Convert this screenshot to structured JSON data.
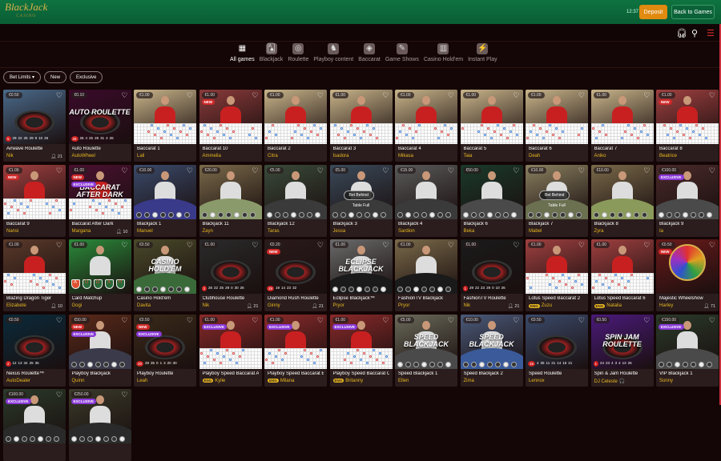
{
  "header": {
    "logo": "BlackJack",
    "logo_sub": "CASINO",
    "clock": "12:37",
    "deposit": "Deposit",
    "back": "Back to Games"
  },
  "tools": {
    "support_icon": "headset-icon",
    "search_icon": "search-icon",
    "menu_icon": "menu-icon"
  },
  "categories": [
    {
      "label": "All games",
      "icon": "grid-icon",
      "glyph": "▦",
      "active": true
    },
    {
      "label": "Blackjack",
      "icon": "cards-icon",
      "glyph": "🂡"
    },
    {
      "label": "Roulette",
      "icon": "roulette-icon",
      "glyph": "◎"
    },
    {
      "label": "Playboy content",
      "icon": "bunny-icon",
      "glyph": "♞"
    },
    {
      "label": "Baccarat",
      "icon": "chips-icon",
      "glyph": "◈"
    },
    {
      "label": "Game Shows",
      "icon": "microphone-icon",
      "glyph": "✎"
    },
    {
      "label": "Casino Hold'em",
      "icon": "holdem-icon",
      "glyph": "▥"
    },
    {
      "label": "Instant Play",
      "icon": "instant-icon",
      "glyph": "⚡"
    }
  ],
  "filters": [
    "Bet Limits ▾",
    "New",
    "Exclusive"
  ],
  "colors": {
    "header": "#0b6a3a",
    "deposit": "#e08a10",
    "dealer": "#e8b820",
    "new": "#d02a2a",
    "exclusive": "#8a3ad8"
  },
  "labels": {
    "new": "NEW",
    "exclusive": "EXCLUSIVE",
    "eng": "ENG",
    "bet_behind": "Bet Behind",
    "table_full": "Table Full"
  },
  "games": [
    {
      "name": "Airwave Roulette",
      "dealer": "Nik",
      "price": "€0.50",
      "players": "21",
      "type": "roulette",
      "scene": "#4a6a8a",
      "nums": [
        "5",
        "29",
        "22",
        "25",
        "29",
        "8",
        "10",
        "26"
      ]
    },
    {
      "name": "Auto Roulette",
      "dealer": "AutoWheel",
      "price": "€0.10",
      "type": "roulette",
      "scene": "#3a0a2a",
      "logo": "AUTO ROULETTE",
      "nums": [
        "25",
        "26",
        "4",
        "25",
        "26",
        "31",
        "4",
        "26"
      ]
    },
    {
      "name": "Baccarat 1",
      "dealer": "Lali",
      "price": "€1.00",
      "type": "baccarat",
      "scene": "#c8b48a"
    },
    {
      "name": "Baccarat 10",
      "dealer": "Ammelia",
      "price": "€1.00",
      "type": "baccarat",
      "scene": "#8a3a3a",
      "new": true
    },
    {
      "name": "Baccarat 2",
      "dealer": "Citra",
      "price": "€1.00",
      "type": "baccarat",
      "scene": "#c8b48a"
    },
    {
      "name": "Baccarat 3",
      "dealer": "Isadora",
      "price": "€1.00",
      "type": "baccarat",
      "scene": "#c8b48a"
    },
    {
      "name": "Baccarat 4",
      "dealer": "Mikasa",
      "price": "€1.00",
      "type": "baccarat",
      "scene": "#c8b48a"
    },
    {
      "name": "Baccarat 5",
      "dealer": "Taia",
      "price": "€1.00",
      "type": "baccarat",
      "scene": "#c8b48a"
    },
    {
      "name": "Baccarat 6",
      "dealer": "Deah",
      "price": "€1.00",
      "type": "baccarat",
      "scene": "#c8b48a"
    },
    {
      "name": "Baccarat 7",
      "dealer": "Aniko",
      "price": "€1.00",
      "type": "baccarat",
      "scene": "#c8b48a"
    },
    {
      "name": "Baccarat 8",
      "dealer": "Beatrice",
      "price": "€1.00",
      "type": "baccarat",
      "scene": "#a04040",
      "new": true
    },
    {
      "name": "Baccarat 9",
      "dealer": "Nansi",
      "price": "€1.00",
      "type": "baccarat",
      "scene": "#a04040",
      "new": true
    },
    {
      "name": "Baccarat After Dark",
      "dealer": "Margana",
      "price": "€1.00",
      "players": "10",
      "type": "baccarat",
      "scene": "#4a1030",
      "new": true,
      "exclusive": true,
      "logo": "BACCARAT AFTER DARK"
    },
    {
      "name": "Blackjack 1",
      "dealer": "Manuel",
      "price": "€10.00",
      "type": "blackjack",
      "scene": "#3a4a6a",
      "felt": "#3a3a8a"
    },
    {
      "name": "Blackjack 11",
      "dealer": "Zayn",
      "price": "€20.00",
      "type": "blackjack",
      "scene": "#7a6a4a",
      "felt": "#8a9a6a"
    },
    {
      "name": "Blackjack 12",
      "dealer": "Taras",
      "price": "€5.00",
      "type": "blackjack",
      "scene": "#3a4a3a",
      "felt": "#3a3a3a"
    },
    {
      "name": "Blackjack 3",
      "dealer": "Jessa",
      "price": "€5.00",
      "type": "blackjack",
      "scene": "#3a4a5a",
      "felt": "#3a3a3a",
      "bet_behind": true
    },
    {
      "name": "Blackjack 4",
      "dealer": "Sardion",
      "price": "€15.00",
      "type": "blackjack",
      "scene": "#5a5a5a",
      "felt": "#3a3a3a"
    },
    {
      "name": "Blackjack 6",
      "dealer": "Beka",
      "price": "€50.00",
      "type": "blackjack",
      "scene": "#1a3a2a",
      "felt": "#4a4a4a"
    },
    {
      "name": "Blackjack 7",
      "dealer": "Mabel",
      "price": "€10.00",
      "type": "blackjack",
      "scene": "#8a8060",
      "felt": "#6a7050",
      "bet_behind": true
    },
    {
      "name": "Blackjack 8",
      "dealer": "Zyra",
      "price": "€10.00",
      "type": "blackjack",
      "scene": "#7a6a4a",
      "felt": "#8a9a5a"
    },
    {
      "name": "Blackjack 9",
      "dealer": "Ia",
      "price": "€100.00",
      "type": "blackjack",
      "scene": "#4a2a2a",
      "felt": "#4a4a4a",
      "exclusive": true
    },
    {
      "name": "Blazing Dragon Tiger",
      "dealer": "Elizabete",
      "price": "€1.00",
      "players": "10",
      "type": "baccarat",
      "scene": "#5a3a2a"
    },
    {
      "name": "Card Matchup",
      "dealer": "Gogi",
      "price": "€1.00",
      "type": "matchup",
      "scene": "#2a8a3a"
    },
    {
      "name": "Casino Hold'em",
      "dealer": "Davita",
      "price": "€0.50",
      "type": "blackjack",
      "scene": "#4a4a2a",
      "felt": "#3a6a3a",
      "logo": "CASINO HOLD'EM"
    },
    {
      "name": "Clubhouse Roulette",
      "dealer": "Nik",
      "price": "€1.00",
      "players": "21",
      "type": "roulette",
      "scene": "#2a2a2a",
      "nums": [
        "3",
        "26",
        "22",
        "25",
        "29",
        "0",
        "30",
        "26"
      ]
    },
    {
      "name": "Diamond Rush Roulette",
      "dealer": "Ginny",
      "price": "€0.20",
      "players": "21",
      "type": "roulette",
      "scene": "#2a1a1a",
      "new": true,
      "nums": [
        "28",
        "19",
        "14",
        "23",
        "32"
      ]
    },
    {
      "name": "Eclipse Blackjack™",
      "dealer": "Pryor",
      "price": "€1.00",
      "type": "blackjack",
      "scene": "#6a6a6a",
      "felt": "#1a1a1a",
      "logo": "ECLIPSE BLACKJACK"
    },
    {
      "name": "FashionTV Blackjack",
      "dealer": "Pryor",
      "price": "€1.00",
      "type": "blackjack",
      "scene": "#7a6a4a",
      "felt": "#1a1a1a"
    },
    {
      "name": "FashionTV Roulette",
      "dealer": "Nik",
      "price": "€1.00",
      "players": "21",
      "type": "roulette",
      "scene": "#1a1a1a",
      "nums": [
        "1",
        "29",
        "22",
        "23",
        "29",
        "0",
        "10",
        "26"
      ]
    },
    {
      "name": "Lotus Speed Baccarat 2",
      "dealer": "Zuzu",
      "price": "€1.00",
      "type": "baccarat",
      "scene": "#a04040",
      "eng": true
    },
    {
      "name": "Lotus Speed Baccarat 6",
      "dealer": "Natalia",
      "price": "€1.00",
      "type": "baccarat",
      "scene": "#a04040",
      "eng": true
    },
    {
      "name": "Majestic Wheelshow",
      "dealer": "Harley",
      "price": "€0.50",
      "players": "71",
      "type": "wheel",
      "scene": "#6a1a1a",
      "new": true
    },
    {
      "name": "Nexus Roulette™",
      "dealer": "AutoDealer",
      "price": "€0.50",
      "type": "roulette",
      "scene": "#0a2a3a",
      "nums": [
        "2",
        "12",
        "13",
        "34",
        "25",
        "35"
      ]
    },
    {
      "name": "Playboy Blackjack",
      "dealer": "Quinn",
      "price": "€50.00",
      "type": "blackjack",
      "scene": "#5a2a1a",
      "felt": "#3a3a4a",
      "new": true,
      "exclusive": true
    },
    {
      "name": "Playboy Roulette",
      "dealer": "Leah",
      "price": "€0.50",
      "type": "roulette",
      "scene": "#3a2a1a",
      "new": true,
      "exclusive": true,
      "nums": [
        "20",
        "28",
        "35",
        "0",
        "1",
        "3",
        "20",
        "30"
      ]
    },
    {
      "name": "Playboy Speed Baccarat A",
      "dealer": "Kylie",
      "price": "€1.00",
      "type": "baccarat",
      "scene": "#8a2a2a",
      "exclusive": true,
      "eng": true
    },
    {
      "name": "Playboy Speed Baccarat B",
      "dealer": "Milana",
      "price": "€1.00",
      "type": "baccarat",
      "scene": "#8a2a2a",
      "exclusive": true,
      "eng": true
    },
    {
      "name": "Playboy Speed Baccarat C",
      "dealer": "Britanny",
      "price": "€1.00",
      "type": "baccarat",
      "scene": "#8a2a2a",
      "exclusive": true,
      "eng": true
    },
    {
      "name": "Speed Blackjack 1",
      "dealer": "Ellen",
      "price": "€5.00",
      "type": "blackjack",
      "scene": "#6a6a5a",
      "felt": "#4a4a4a",
      "logo": "SPEED BLACKJACK"
    },
    {
      "name": "Speed Blackjack 2",
      "dealer": "Zima",
      "price": "€10.00",
      "type": "blackjack",
      "scene": "#4a5a7a",
      "felt": "#3a5a9a",
      "logo": "SPEED BLACKJACK"
    },
    {
      "name": "Speed Roulette",
      "dealer": "Lennox",
      "price": "€0.50",
      "type": "roulette",
      "scene": "#3a4a6a",
      "nums": [
        "16",
        "4",
        "35",
        "11",
        "21",
        "14",
        "15",
        "21"
      ]
    },
    {
      "name": "Spin & Jam Roulette",
      "dealer": "DJ Celeste 🎧",
      "price": "€0.50",
      "type": "roulette",
      "scene": "#4a1a7a",
      "logo": "SPIN JAM ROULETTE",
      "nums": [
        "1",
        "24",
        "23",
        "4",
        "3",
        "4",
        "13",
        "26"
      ]
    },
    {
      "name": "VIP Blackjack 1",
      "dealer": "Sonny",
      "price": "€150.00",
      "type": "blackjack",
      "scene": "#2a3a2a",
      "felt": "#4a4a4a",
      "exclusive": true
    },
    {
      "name": "",
      "dealer": "",
      "price": "€100.00",
      "type": "blackjack",
      "scene": "#2a3a2a",
      "felt": "#2a2a2a",
      "exclusive": true
    },
    {
      "name": "",
      "dealer": "",
      "price": "€250.00",
      "type": "blackjack",
      "scene": "#3a3a2a",
      "felt": "#2a2a2a",
      "exclusive": true
    }
  ]
}
